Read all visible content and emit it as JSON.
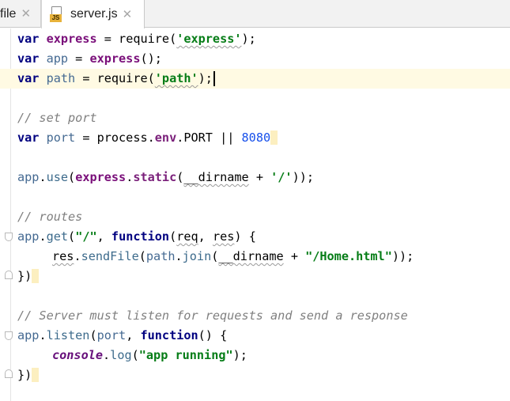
{
  "tabs": [
    {
      "label": "file",
      "close": "✕"
    },
    {
      "label": "server.js",
      "icon_badge": "JS",
      "close": "✕"
    }
  ],
  "code": {
    "l1": {
      "kw": "var",
      "name": "express",
      "eq": " = ",
      "fn": "require",
      "open": "(",
      "str": "'express'",
      "close": ");"
    },
    "l2": {
      "kw": "var",
      "name": "app",
      "eq": " = ",
      "fn": "express",
      "call": "();"
    },
    "l3": {
      "kw": "var",
      "name": "path",
      "eq": " = ",
      "fn": "require",
      "open": "(",
      "str": "'path'",
      "close": ");"
    },
    "l5": {
      "comment": "// set port"
    },
    "l6": {
      "kw": "var",
      "name": "port",
      "eq": " = ",
      "obj": "process",
      "dot": ".",
      "prop": "env",
      "dot2": ".",
      "const": "PORT",
      "or": " || ",
      "num": "8080"
    },
    "l8": {
      "obj": "app",
      "dot": ".",
      "method": "use",
      "open": "(",
      "ns": "express",
      "dot2": ".",
      "prop": "static",
      "open2": "(",
      "dirname": "__dirname",
      "plus": " + ",
      "str": "'/'",
      "close": "));"
    },
    "l10": {
      "comment": "// routes"
    },
    "l11": {
      "obj": "app",
      "dot": ".",
      "method": "get",
      "open": "(",
      "str": "\"/\"",
      "comma": ", ",
      "kw": "function",
      "open2": "(",
      "p1": "req",
      "comma2": ", ",
      "p2": "res",
      "close": ") {"
    },
    "l12": {
      "obj": "res",
      "dot": ".",
      "method": "sendFile",
      "open": "(",
      "obj2": "path",
      "dot2": ".",
      "method2": "join",
      "open2": "(",
      "dirname": "__dirname",
      "plus": " + ",
      "str": "\"/Home.html\"",
      "close": "));"
    },
    "l13": {
      "text": "})"
    },
    "l15": {
      "comment": "// Server must listen for requests and send a response"
    },
    "l16": {
      "obj": "app",
      "dot": ".",
      "method": "listen",
      "open": "(",
      "arg": "port",
      "comma": ", ",
      "kw": "function",
      "close": "() {"
    },
    "l17": {
      "con": "console",
      "dot": ".",
      "method": "log",
      "open": "(",
      "str": "\"app running\"",
      "close": ");"
    },
    "l18": {
      "text": "})"
    }
  },
  "colors": {
    "keyword": "#000080",
    "string": "#067d17",
    "number": "#1750eb",
    "comment": "#808080",
    "current_line": "#fffae3",
    "js_badge": "#e8b23a"
  }
}
